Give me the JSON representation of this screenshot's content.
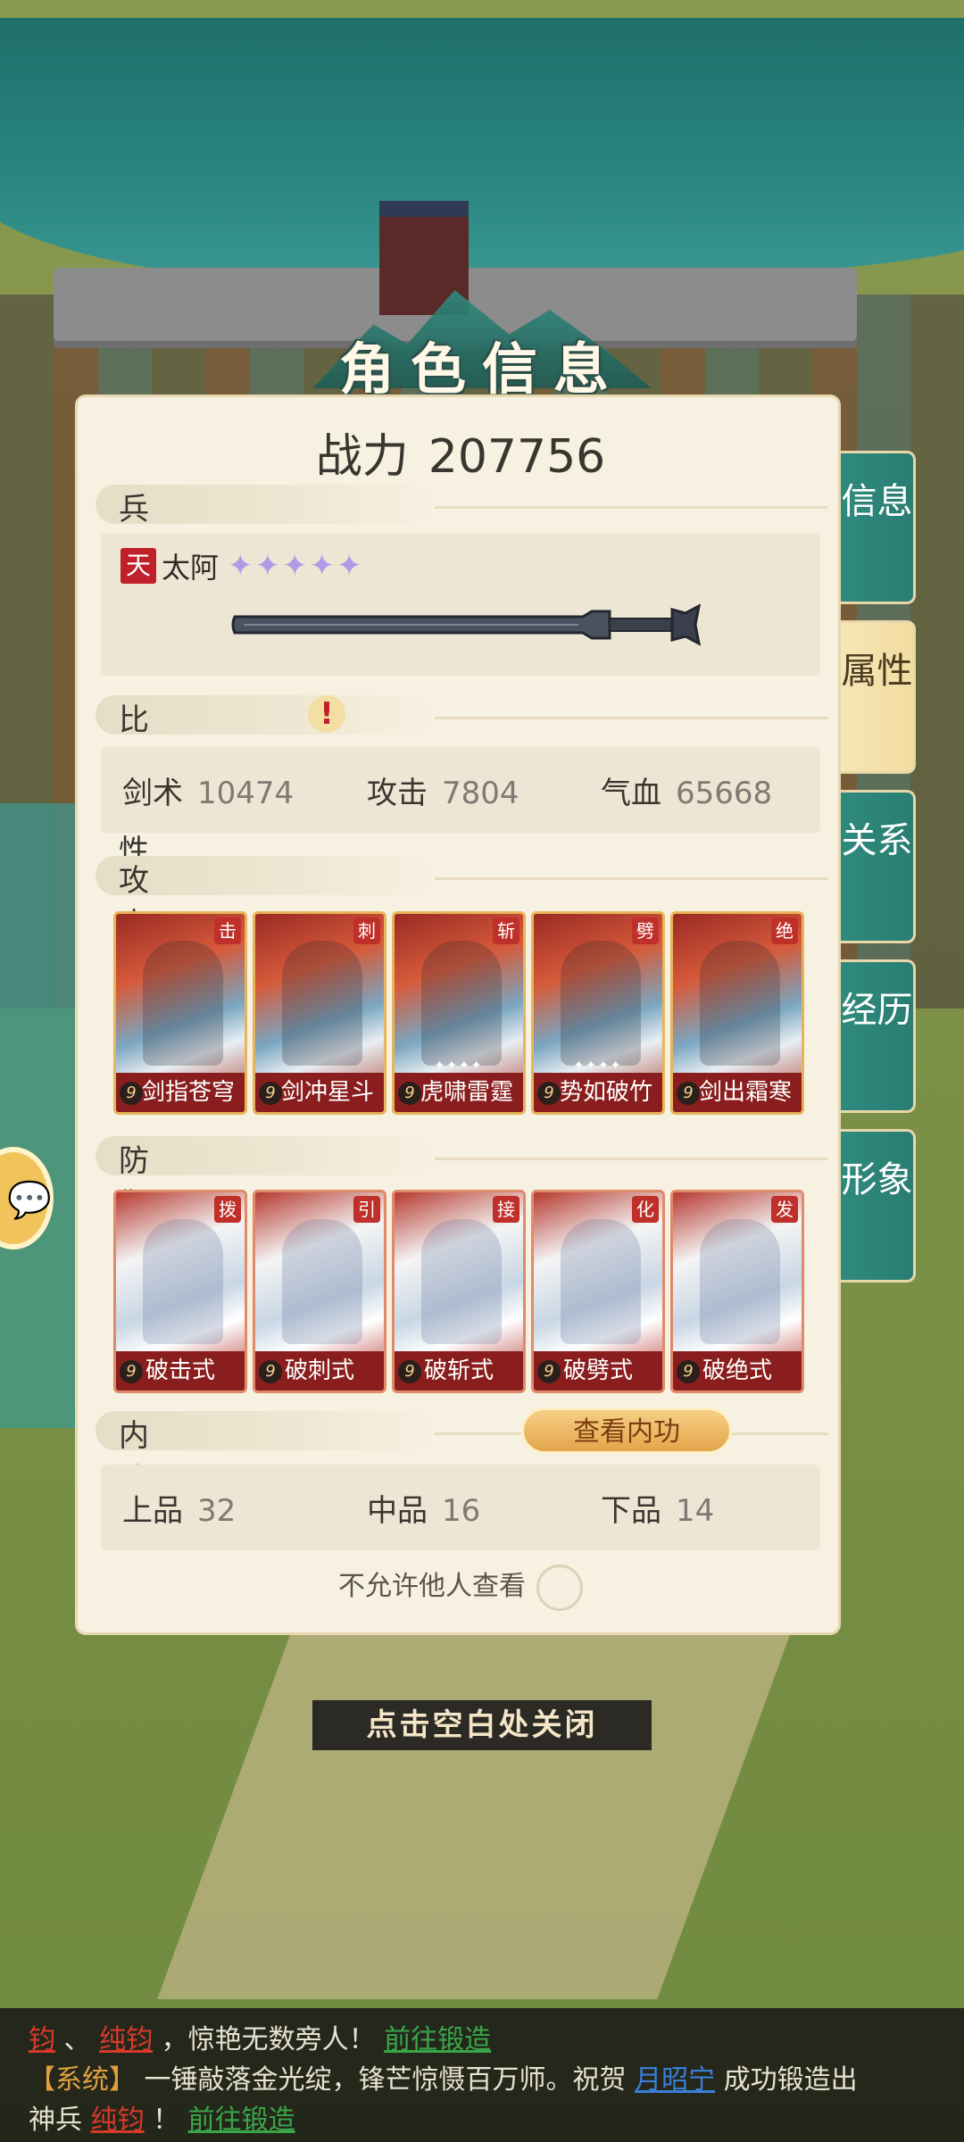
{
  "header": {
    "title": "角色信息"
  },
  "power": {
    "label": "战力",
    "value": "207756"
  },
  "weapon_section": {
    "heading": "兵器",
    "grade": "天",
    "name": "太阿",
    "stars": "✦✦✦✦✦"
  },
  "combat_section": {
    "heading": "比武属性",
    "stats": [
      {
        "label": "剑术",
        "value": "10474"
      },
      {
        "label": "攻击",
        "value": "7804"
      },
      {
        "label": "气血",
        "value": "65668"
      }
    ]
  },
  "attack_section": {
    "heading": "攻击招式",
    "cards": [
      {
        "tag": "击",
        "level": "9",
        "name": "剑指苍穹",
        "stars": ""
      },
      {
        "tag": "刺",
        "level": "9",
        "name": "剑冲星斗",
        "stars": ""
      },
      {
        "tag": "斩",
        "level": "9",
        "name": "虎啸雷霆",
        "stars": "✦✦✦✦"
      },
      {
        "tag": "劈",
        "level": "9",
        "name": "势如破竹",
        "stars": "✦✦✦✦"
      },
      {
        "tag": "绝",
        "level": "9",
        "name": "剑出霜寒",
        "stars": ""
      }
    ]
  },
  "defense_section": {
    "heading": "防御招式",
    "cards": [
      {
        "tag": "拨",
        "level": "9",
        "name": "破击式"
      },
      {
        "tag": "引",
        "level": "9",
        "name": "破刺式"
      },
      {
        "tag": "接",
        "level": "9",
        "name": "破斩式"
      },
      {
        "tag": "化",
        "level": "9",
        "name": "破劈式"
      },
      {
        "tag": "发",
        "level": "9",
        "name": "破绝式"
      }
    ]
  },
  "neigong_section": {
    "heading": "内功",
    "view_button": "查看内功",
    "stats": [
      {
        "label": "上品",
        "value": "32"
      },
      {
        "label": "中品",
        "value": "16"
      },
      {
        "label": "下品",
        "value": "14"
      }
    ]
  },
  "privacy": {
    "label": "不允许他人查看"
  },
  "tabs": [
    {
      "label": "信息"
    },
    {
      "label": "属性"
    },
    {
      "label": "关系"
    },
    {
      "label": "经历"
    },
    {
      "label": "形象"
    }
  ],
  "close_tip": "点击空白处关闭",
  "chat": {
    "line1": {
      "item1": "钧",
      "sep": "、",
      "item2": "纯钧",
      "text": "，惊艳无数旁人！",
      "link": "前往锻造"
    },
    "line2": {
      "prefix": "【系统】",
      "text": "一锤敲落金光绽，锋芒惊慑百万师。祝贺",
      "player": "月昭宁",
      "text2": "成功锻造出"
    },
    "line3": {
      "text": "神兵",
      "item": "纯钧",
      "text2": "！",
      "link": "前往锻造"
    }
  },
  "colors": {
    "accent_teal": "#2a7d72",
    "panel_bg": "#f7f1e2",
    "active_tab": "#f2dca0"
  }
}
